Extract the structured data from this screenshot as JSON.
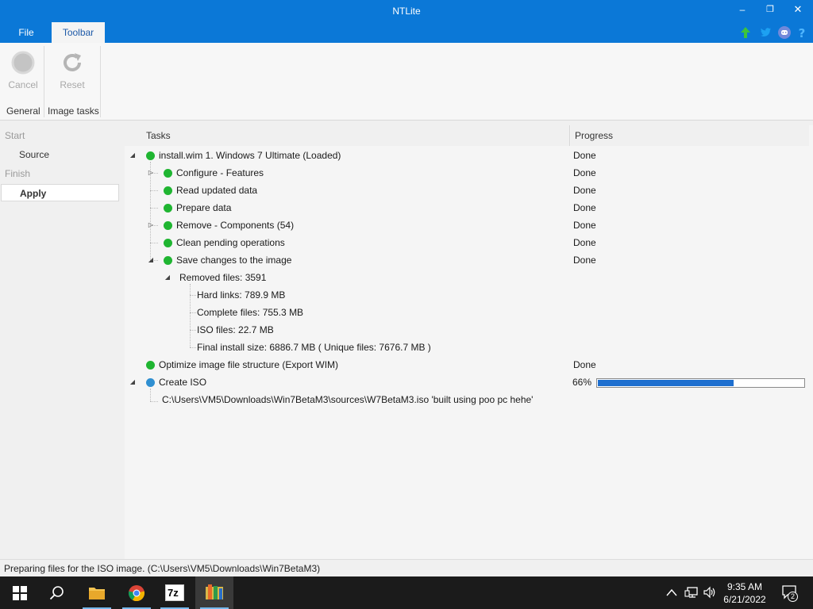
{
  "window": {
    "title": "NTLite",
    "minimize": "–",
    "maximize": "❐",
    "close": "✕"
  },
  "menu": {
    "file": "File",
    "toolbar": "Toolbar"
  },
  "ribbon": {
    "cancel_label": "Cancel",
    "reset_label": "Reset",
    "group_general": "General",
    "group_image_tasks": "Image tasks"
  },
  "sidebar": {
    "start": "Start",
    "source": "Source",
    "finish": "Finish",
    "apply": "Apply"
  },
  "columns": {
    "tasks": "Tasks",
    "progress": "Progress"
  },
  "tasks": {
    "root": "install.wim 1. Windows 7 Ultimate  (Loaded)",
    "configure": "Configure - Features",
    "read_updated": "Read updated data",
    "prepare": "Prepare data",
    "remove": "Remove - Components (54)",
    "clean": "Clean pending operations",
    "save": "Save changes to the image",
    "removed_files": "Removed files: 3591",
    "hard_links": "Hard links: 789.9 MB",
    "complete_files": "Complete files: 755.3 MB",
    "iso_files": "ISO files: 22.7 MB",
    "final_size": "Final install size: 6886.7 MB ( Unique files: 7676.7 MB )",
    "optimize": "Optimize image file structure (Export WIM)",
    "create_iso": "Create ISO",
    "iso_path": "C:\\Users\\VM5\\Downloads\\Win7BetaM3\\sources\\W7BetaM3.iso 'built using poo pc hehe'"
  },
  "progress": {
    "done": "Done",
    "create_iso_percent": "66%",
    "create_iso_fraction": 0.66
  },
  "status": "Preparing files for the ISO image. (C:\\Users\\VM5\\Downloads\\Win7BetaM3)",
  "taskbar": {
    "time": "9:35 AM",
    "date": "6/21/2022",
    "notifications": "2",
    "app_7z": "7z"
  },
  "colors": {
    "accent": "#0b78d7",
    "done_dot": "#1fb531",
    "active_dot": "#2f8fd1",
    "progress_fill": "#1e6fcf"
  }
}
